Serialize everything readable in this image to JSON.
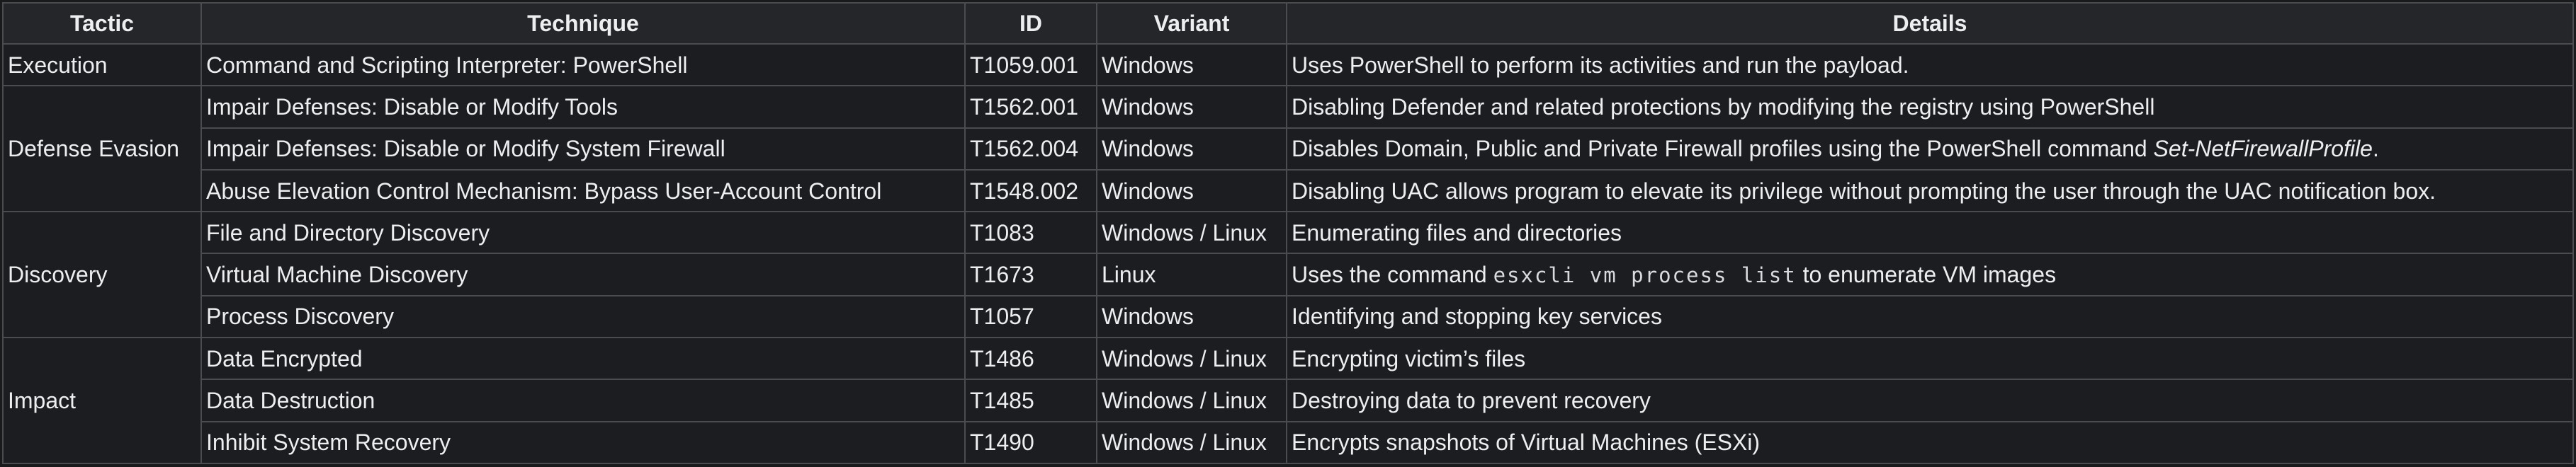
{
  "headers": {
    "tactic": "Tactic",
    "technique": "Technique",
    "id": "ID",
    "variant": "Variant",
    "details": "Details"
  },
  "groups": [
    {
      "tactic": "Execution",
      "rows": [
        {
          "technique": "Command and Scripting Interpreter: PowerShell",
          "id": "T1059.001",
          "variant": "Windows",
          "details": [
            {
              "text": "Uses PowerShell to perform its activities and run the payload.",
              "style": "normal"
            }
          ]
        }
      ]
    },
    {
      "tactic": "Defense Evasion",
      "rows": [
        {
          "technique": "Impair Defenses: Disable or Modify Tools",
          "id": "T1562.001",
          "variant": "Windows",
          "details": [
            {
              "text": "Disabling Defender and related protections by modifying the registry using PowerShell",
              "style": "normal"
            }
          ]
        },
        {
          "technique": "Impair Defenses: Disable or Modify System Firewall",
          "id": "T1562.004",
          "variant": "Windows",
          "details": [
            {
              "text": "Disables Domain, Public and Private Firewall profiles using the PowerShell command ",
              "style": "normal"
            },
            {
              "text": "Set-NetFirewallProfile",
              "style": "italic"
            },
            {
              "text": ".",
              "style": "normal"
            }
          ]
        },
        {
          "technique": "Abuse Elevation Control Mechanism: Bypass User-Account Control",
          "id": "T1548.002",
          "variant": "Windows",
          "details": [
            {
              "text": "Disabling UAC allows program to elevate its privilege without prompting the user through the UAC notification box.",
              "style": "normal"
            }
          ]
        }
      ]
    },
    {
      "tactic": "Discovery",
      "rows": [
        {
          "technique": "File and Directory Discovery",
          "id": "T1083",
          "variant": "Windows / Linux",
          "details": [
            {
              "text": "Enumerating files and directories",
              "style": "normal"
            }
          ]
        },
        {
          "technique": "Virtual Machine Discovery",
          "id": "T1673",
          "variant": "Linux",
          "details": [
            {
              "text": "Uses the command ",
              "style": "normal"
            },
            {
              "text": "esxcli vm process list",
              "style": "mono"
            },
            {
              "text": " to enumerate VM images",
              "style": "normal"
            }
          ]
        },
        {
          "technique": "Process Discovery",
          "id": "T1057",
          "variant": "Windows",
          "details": [
            {
              "text": "Identifying and stopping key services",
              "style": "normal"
            }
          ]
        }
      ]
    },
    {
      "tactic": "Impact",
      "rows": [
        {
          "technique": "Data Encrypted",
          "id": "T1486",
          "variant": "Windows / Linux",
          "details": [
            {
              "text": "Encrypting victim’s files",
              "style": "normal"
            }
          ]
        },
        {
          "technique": "Data Destruction",
          "id": "T1485",
          "variant": "Windows / Linux",
          "details": [
            {
              "text": "Destroying data to prevent recovery",
              "style": "normal"
            }
          ]
        },
        {
          "technique": "Inhibit System Recovery",
          "id": "T1490",
          "variant": "Windows / Linux",
          "details": [
            {
              "text": "Encrypts snapshots of Virtual Machines (ESXi)",
              "style": "normal"
            }
          ]
        }
      ]
    }
  ]
}
